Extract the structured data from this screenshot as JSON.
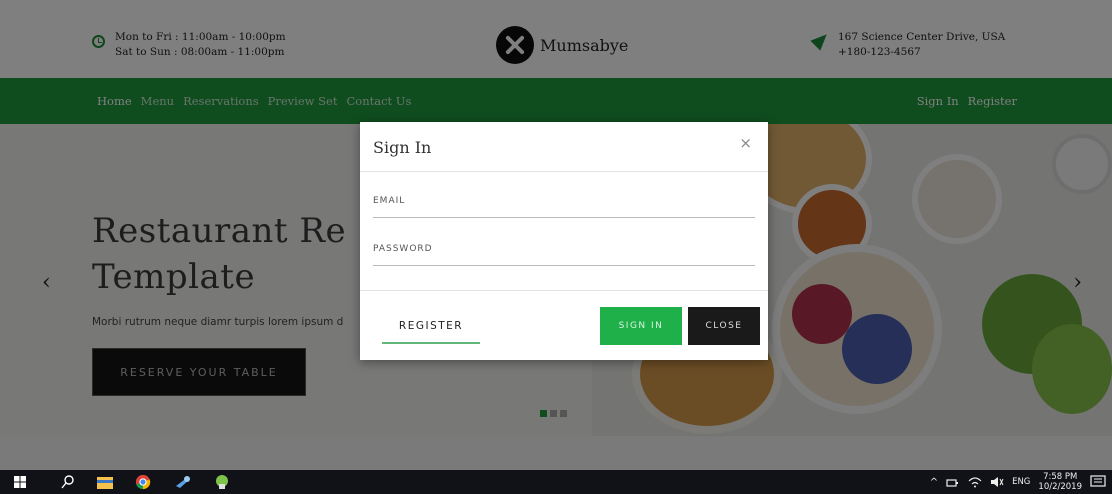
{
  "header": {
    "hours": [
      "Mon to Fri : 11:00am - 10:00pm",
      "Sat to Sun : 08:00am - 11:00pm"
    ],
    "logo_text": "Mumsabye",
    "address": [
      "167 Science Center Drive, USA",
      "+180-123-4567"
    ]
  },
  "nav": {
    "items": [
      "Home",
      "Menu",
      "Reservations",
      "Preview Set",
      "Contact Us"
    ],
    "active": "Home",
    "right": [
      "Sign In",
      "Register"
    ]
  },
  "hero": {
    "title_line1": "Restaurant Re",
    "title_line2": "Template",
    "subtitle": "Morbi rutrum neque diamr turpis lorem ipsum d",
    "reserve_label": "RESERVE YOUR TABLE",
    "prev_arrow": "‹",
    "next_arrow": "›",
    "slides": 3,
    "active_slide": 1
  },
  "modal": {
    "title": "Sign In",
    "close_icon": "×",
    "email_label": "EMAIL",
    "password_label": "PASSWORD",
    "register_label": "REGISTER",
    "signin_label": "SIGN IN",
    "close_label": "CLOSE"
  },
  "taskbar": {
    "tray_chevron": "^",
    "language": "ENG",
    "time": "7:58 PM",
    "date": "10/2/2019"
  },
  "colors": {
    "brand_green": "#1f9a3c",
    "signin_green": "#1fb04a"
  }
}
